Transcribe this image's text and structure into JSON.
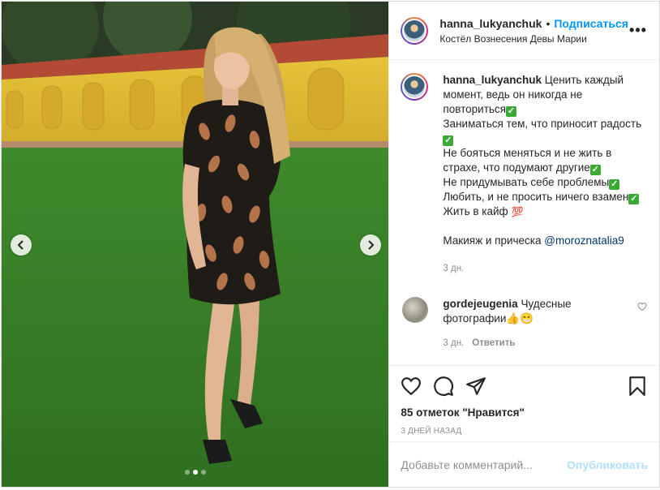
{
  "post": {
    "author": "hanna_lukyanchuk",
    "separator": "•",
    "follow_label": "Подписаться",
    "location": "Костёл Вознесения Девы Марии",
    "more_label": "•••"
  },
  "caption": {
    "author": "hanna_lukyanchuk",
    "lines": [
      "Ценить каждый момент, ведь он никогда не повториться",
      "Заниматься тем, что приносит радость",
      "Не бояться меняться и не жить в страхе, что подумают другие",
      "Не придумывать себе проблемы",
      "Любить, и не просить ничего взамен",
      "Жить в кайф"
    ],
    "credit_prefix": "Макияж и прическа ",
    "credit_mention": "@moroznatalia9",
    "time": "3 дн."
  },
  "comment": {
    "author": "gordejeugenia",
    "text": "Чудесные фотографии",
    "emoji": "👍😁",
    "time": "3 дн.",
    "reply_label": "Ответить"
  },
  "likes_text": "85 отметок \"Нравится\"",
  "date_text": "3 дней назад",
  "add_comment": {
    "placeholder": "Добавьте комментарий...",
    "publish_label": "Опубликовать"
  },
  "icons": {
    "like": "heart-icon",
    "comment": "comment-icon",
    "share": "share-icon",
    "save": "bookmark-icon"
  },
  "carousel": {
    "slides": 3,
    "active": 2
  },
  "colors": {
    "accent": "#0095f6",
    "publish_disabled": "#b2dffc",
    "check": "#3aaa35"
  }
}
